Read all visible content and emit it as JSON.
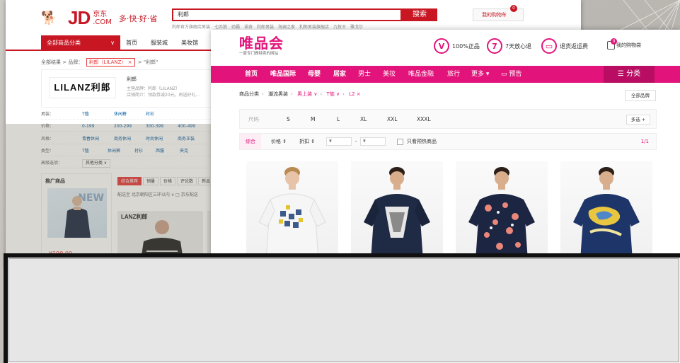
{
  "jd": {
    "logo_text": "JD",
    "logo_cn_top": "京东",
    "logo_cn_bottom": ".COM",
    "slogan": "多·快·好·省",
    "search_value": "利郎",
    "search_button": "搜索",
    "hot_words": "利郎官方旗舰店男装　七匹狼　劲霸　诺奇　利郎男装　海澜之家　利郎男装旗舰店　九牧王　雅戈尔",
    "cart_label": "我的购物车",
    "cart_count": "0",
    "all_categories": "全部商品分类",
    "nav": [
      "首页",
      "服装城",
      "美妆馆"
    ],
    "breadcrumb_prefix": "全部结果 >  品牌：",
    "breadcrumb_tag": "利郎（LILANZ） ×",
    "breadcrumb_suffix": "> \"利郎\"",
    "brand_logo": "LILANZ利郎",
    "brand_name": "利郎",
    "brand_info_1": "主营品牌：利郎（LILANZ）",
    "brand_info_2": "店铺简介：领款券减20元，再送好礼...",
    "filters": [
      {
        "key": "男装：",
        "values": [
          "T恤",
          "休闲裤",
          "衬衫"
        ]
      },
      {
        "key": "价格：",
        "values": [
          "0-199",
          "200-299",
          "300-399",
          "400-499"
        ]
      },
      {
        "key": "风格：",
        "values": [
          "青春休闲",
          "商务休闲",
          "时尚休闲",
          "商务正装"
        ]
      },
      {
        "key": "类型：",
        "values": [
          "T恤",
          "休闲裤",
          "衬衫",
          "西服",
          "夹克"
        ]
      },
      {
        "key": "高级选项：",
        "values": [
          "其他分类 ∨"
        ]
      }
    ],
    "promo_title": "推广商品",
    "promo_banner": "NEW",
    "promo_price": "¥199.00",
    "sort_tabs": [
      "综合推荐",
      "销量",
      "价格",
      "评论数",
      "新品"
    ],
    "ship_to": "配送至  北京朝阳区三环以内 ∨    □ 京东配送"
  },
  "vip": {
    "logo": "唯品会",
    "logo_sub": "一家专门做特卖的网站",
    "badges": [
      {
        "icon": "V",
        "label": "100%正品"
      },
      {
        "icon": "7",
        "label": "7天放心退"
      },
      {
        "icon": "▭",
        "label": "退货返运费"
      }
    ],
    "cart_label": "我的购物袋",
    "cart_count": "0",
    "nav": [
      "首页",
      "唯品国际",
      "母婴",
      "居家",
      "男士",
      "美妆",
      "唯品金融",
      "旅行",
      "更多 ▾",
      "▭ 预告"
    ],
    "category_button": "☰ 分类",
    "breadcrumb": [
      "商品分类",
      "潮流男装",
      "男上装 ∨",
      "T恤 ∨",
      "L2 ×"
    ],
    "all_brands": "全部品牌",
    "size_label": "尺码",
    "sizes": [
      "S",
      "M",
      "L",
      "XL",
      "XXL",
      "XXXL"
    ],
    "multi_select": "多选 +",
    "sort": [
      "综合",
      "价格 ⇕",
      "折扣 ⇕"
    ],
    "price_from": "¥",
    "price_dash": "-",
    "price_to": "¥",
    "only_presale": "只看预热商品",
    "page": "1/1"
  },
  "colors": {
    "jd_red": "#c81623",
    "vip_pink": "#e2147b"
  }
}
